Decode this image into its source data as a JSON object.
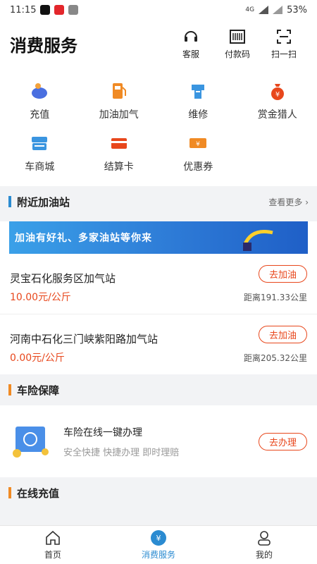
{
  "status": {
    "time": "11:15",
    "battery": "53%",
    "net": "4G"
  },
  "header": {
    "title": "消费服务",
    "actions": [
      {
        "label": "客服"
      },
      {
        "label": "付款码"
      },
      {
        "label": "扫一扫"
      }
    ]
  },
  "grid": [
    {
      "label": "充值"
    },
    {
      "label": "加油加气"
    },
    {
      "label": "维修"
    },
    {
      "label": "赏金猎人"
    },
    {
      "label": "车商城"
    },
    {
      "label": "结算卡"
    },
    {
      "label": "优惠券"
    }
  ],
  "nearby": {
    "title": "附近加油站",
    "more": "查看更多 ›",
    "banner_text": "加油有好礼、多家油站等你来",
    "stations": [
      {
        "name": "灵宝石化服务区加气站",
        "price": "10.00元/公斤",
        "action": "去加油",
        "distance": "距离191.33公里"
      },
      {
        "name": "河南中石化三门峡紫阳路加气站",
        "price": "0.00元/公斤",
        "action": "去加油",
        "distance": "距离205.32公里"
      }
    ]
  },
  "insurance": {
    "title": "车险保障",
    "item_title": "车险在线一键办理",
    "item_sub": "安全快捷  快捷办理  即时理赔",
    "action": "去办理"
  },
  "recharge": {
    "title": "在线充值"
  },
  "tabs": [
    {
      "label": "首页"
    },
    {
      "label": "消费服务"
    },
    {
      "label": "我的"
    }
  ],
  "colors": {
    "accent": "#2b8bd1",
    "orange": "#f08a24",
    "red": "#e8471c"
  }
}
